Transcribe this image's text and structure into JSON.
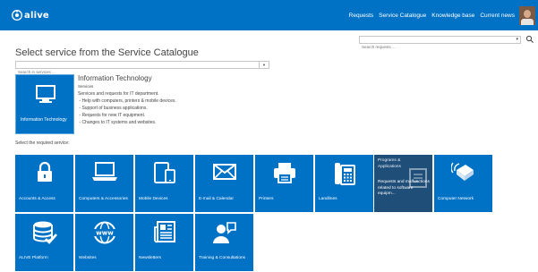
{
  "app": {
    "logo_text": "alive"
  },
  "nav": {
    "items": [
      "Requests",
      "Service Catalogue",
      "Knowledge base",
      "Current news"
    ]
  },
  "request_search": {
    "placeholder": "Search requests ..."
  },
  "page": {
    "title": "Select service from the Service Catalogue",
    "search_placeholder": "Search in services ..."
  },
  "category": {
    "tile_label": "Information Technology",
    "title": "Information Technology",
    "subtitle": "Services",
    "description": "Services and requests for IT department.\n - Help with computers, printers & mobile devices.\n - Support of business applications.\n - Requests for new IT equipment.\n - Changes to IT systems and websites."
  },
  "select_label": "Select the required service:",
  "services": [
    {
      "label": "Accounts & Access",
      "icon": "lock-icon"
    },
    {
      "label": "Computers & Accessories",
      "icon": "laptop-icon"
    },
    {
      "label": "Mobile Devices",
      "icon": "mobile-device-icon"
    },
    {
      "label": "E-mail & Calendar",
      "icon": "envelope-icon"
    },
    {
      "label": "Printers",
      "icon": "printer-icon"
    },
    {
      "label": "Landlines",
      "icon": "desk-phone-icon"
    },
    {
      "label": "Requests and malfunctions related to software equipm...",
      "title": "Programs & Applications",
      "icon": "application-icon",
      "state": "hover"
    },
    {
      "label": "Computer Network",
      "icon": "network-icon"
    },
    {
      "label": "ALIVE Platform",
      "icon": "database-check-icon"
    },
    {
      "label": "Websites",
      "icon": "globe-www-icon"
    },
    {
      "label": "Newsletters",
      "icon": "newspaper-icon"
    },
    {
      "label": "Training & Consultations",
      "icon": "consultation-icon"
    }
  ],
  "colors": {
    "header": "#0072c6",
    "tile": "#0072c6",
    "tile_hover": "#1f4e79"
  }
}
